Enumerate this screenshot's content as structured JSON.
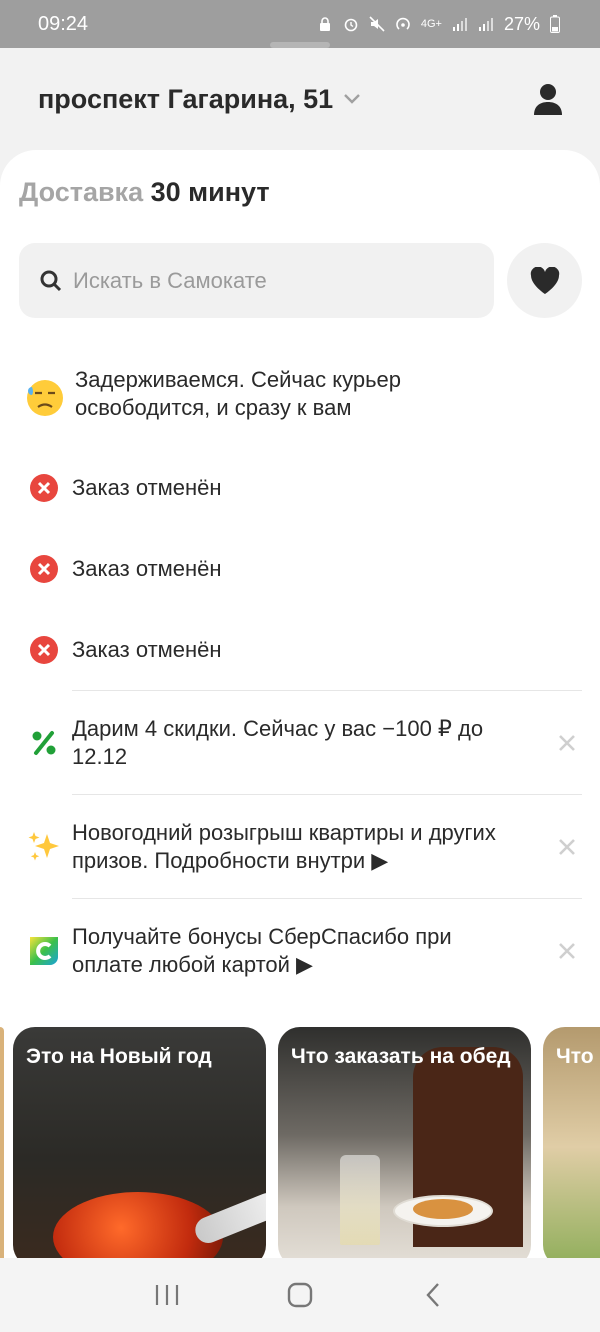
{
  "status_bar": {
    "time": "09:24",
    "battery": "27%",
    "network": "4G+"
  },
  "header": {
    "address": "проспект Гагарина, 51"
  },
  "delivery": {
    "label": "Доставка",
    "time": "30 минут"
  },
  "search": {
    "placeholder": "Искать в Самокате"
  },
  "orders": [
    {
      "icon": "sad-sweat-emoji-icon",
      "text": "Задерживаемся. Сейчас курьер освободится, и сразу к вам"
    },
    {
      "icon": "cancel-circle-icon",
      "text": "Заказ отменён"
    },
    {
      "icon": "cancel-circle-icon",
      "text": "Заказ отменён"
    },
    {
      "icon": "cancel-circle-icon",
      "text": "Заказ отменён"
    }
  ],
  "promos": [
    {
      "icon": "percent-icon",
      "text": "Дарим 4 скидки. Сейчас у вас −100 ₽ до 12.12"
    },
    {
      "icon": "sparkles-icon",
      "text": "Новогодний розыгрыш квартиры и других призов. Подробности внутри ▶"
    },
    {
      "icon": "sberspasibo-icon",
      "text": "Получайте бонусы СберСпасибо при оплате любой картой ▶"
    }
  ],
  "stories": [
    {
      "title": "Это на Новый год"
    },
    {
      "title": "Что заказать на обед"
    },
    {
      "title": "Что от С"
    }
  ],
  "colors": {
    "accent_red": "#e8463e",
    "promo_green": "#21a038",
    "text": "#2a2a2a",
    "muted": "#a5a5a5"
  }
}
